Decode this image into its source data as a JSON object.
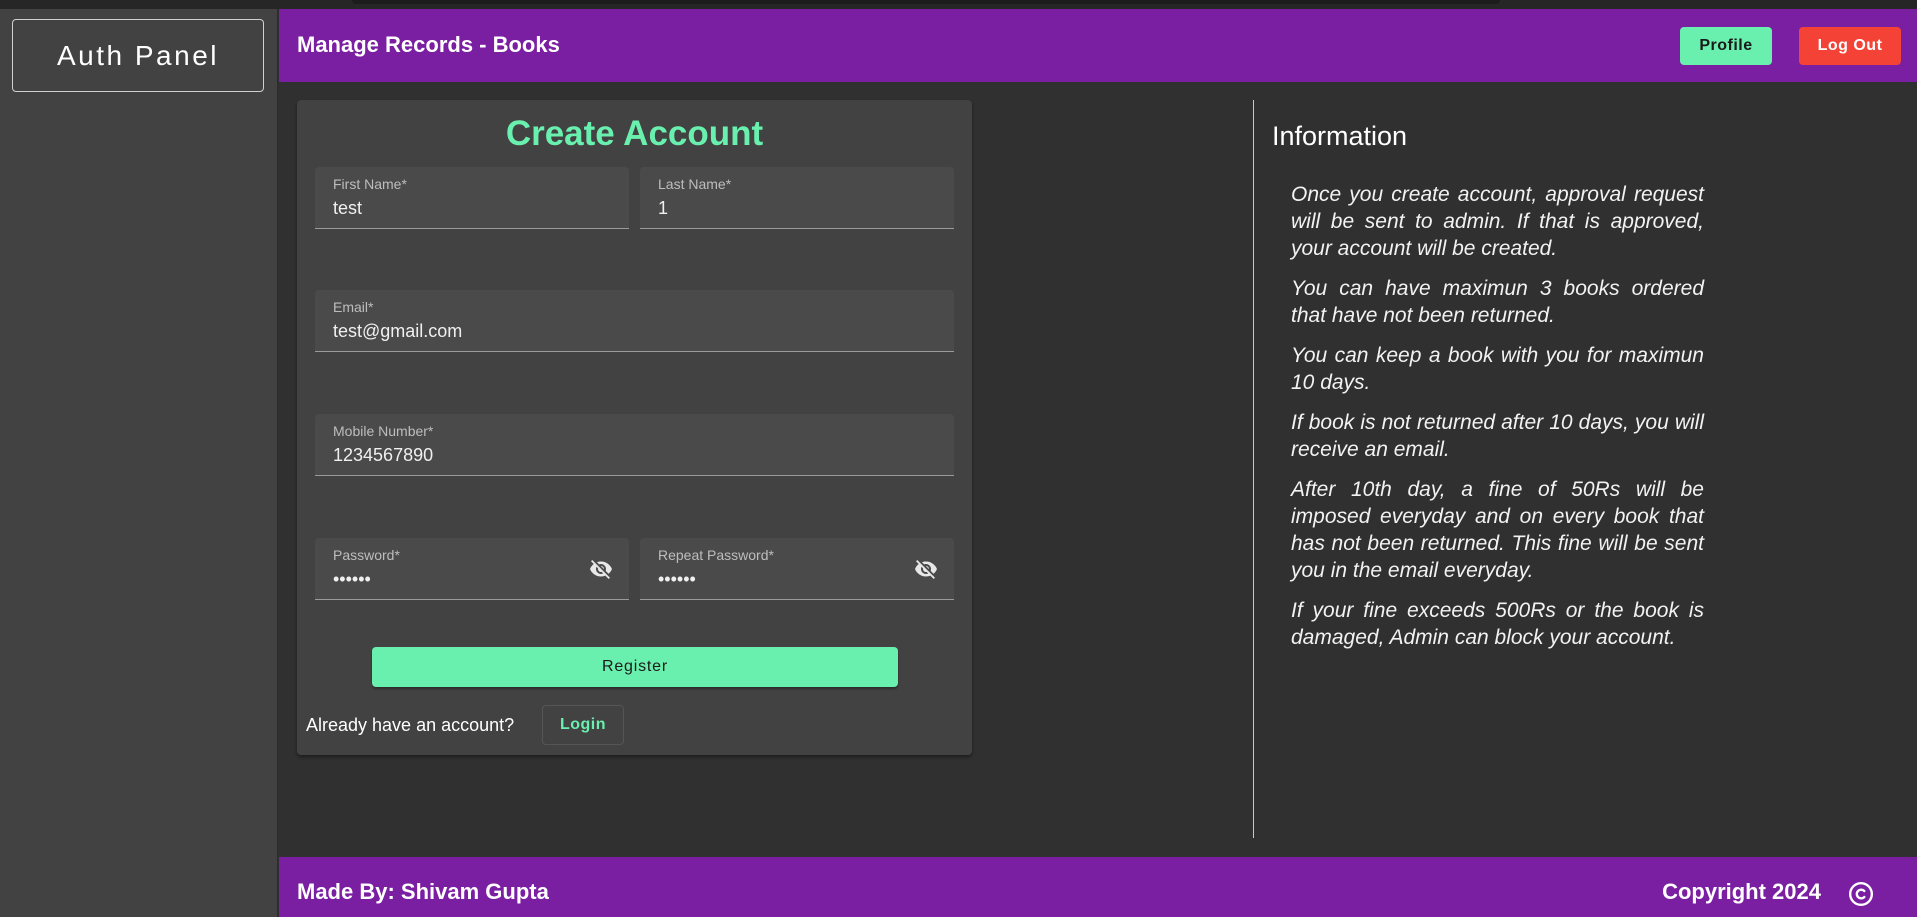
{
  "sidebar": {
    "brand": "Auth Panel"
  },
  "header": {
    "title": "Manage Records - Books",
    "profile_label": "Profile",
    "logout_label": "Log Out"
  },
  "form": {
    "title": "Create Account",
    "first_name": {
      "label": "First Name*",
      "value": "test"
    },
    "last_name": {
      "label": "Last Name*",
      "value": "1"
    },
    "email": {
      "label": "Email*",
      "value": "test@gmail.com"
    },
    "mobile": {
      "label": "Mobile Number*",
      "value": "1234567890"
    },
    "password": {
      "label": "Password*",
      "value": "••••••"
    },
    "repeat_password": {
      "label": "Repeat Password*",
      "value": "••••••"
    },
    "register_label": "Register",
    "already_text": "Already have an account?",
    "login_label": "Login"
  },
  "info": {
    "title": "Information",
    "items": [
      "Once you create account, approval request will be sent to admin. If that is approved, your account will be created.",
      "You can have maximun 3 books ordered that have not been returned.",
      "You can keep a book with you for maximun 10 days.",
      "If book is not returned after 10 days, you will receive an email.",
      "After 10th day, a fine of 50Rs will be imposed everyday and on every book that has not been returned. This fine will be sent you in the email everyday.",
      "If your fine exceeds 500Rs or the book is damaged, Admin can block your account."
    ]
  },
  "footer": {
    "made_by": "Made By: Shivam Gupta",
    "copyright": "Copyright 2024"
  },
  "icons": {
    "password_toggle": "eye-off-icon",
    "copyright": "copyright-icon"
  },
  "colors": {
    "primary": "#7b1fa2",
    "accent": "#69f0ae",
    "danger": "#f44336",
    "background": "#303030",
    "surface": "#424242"
  }
}
